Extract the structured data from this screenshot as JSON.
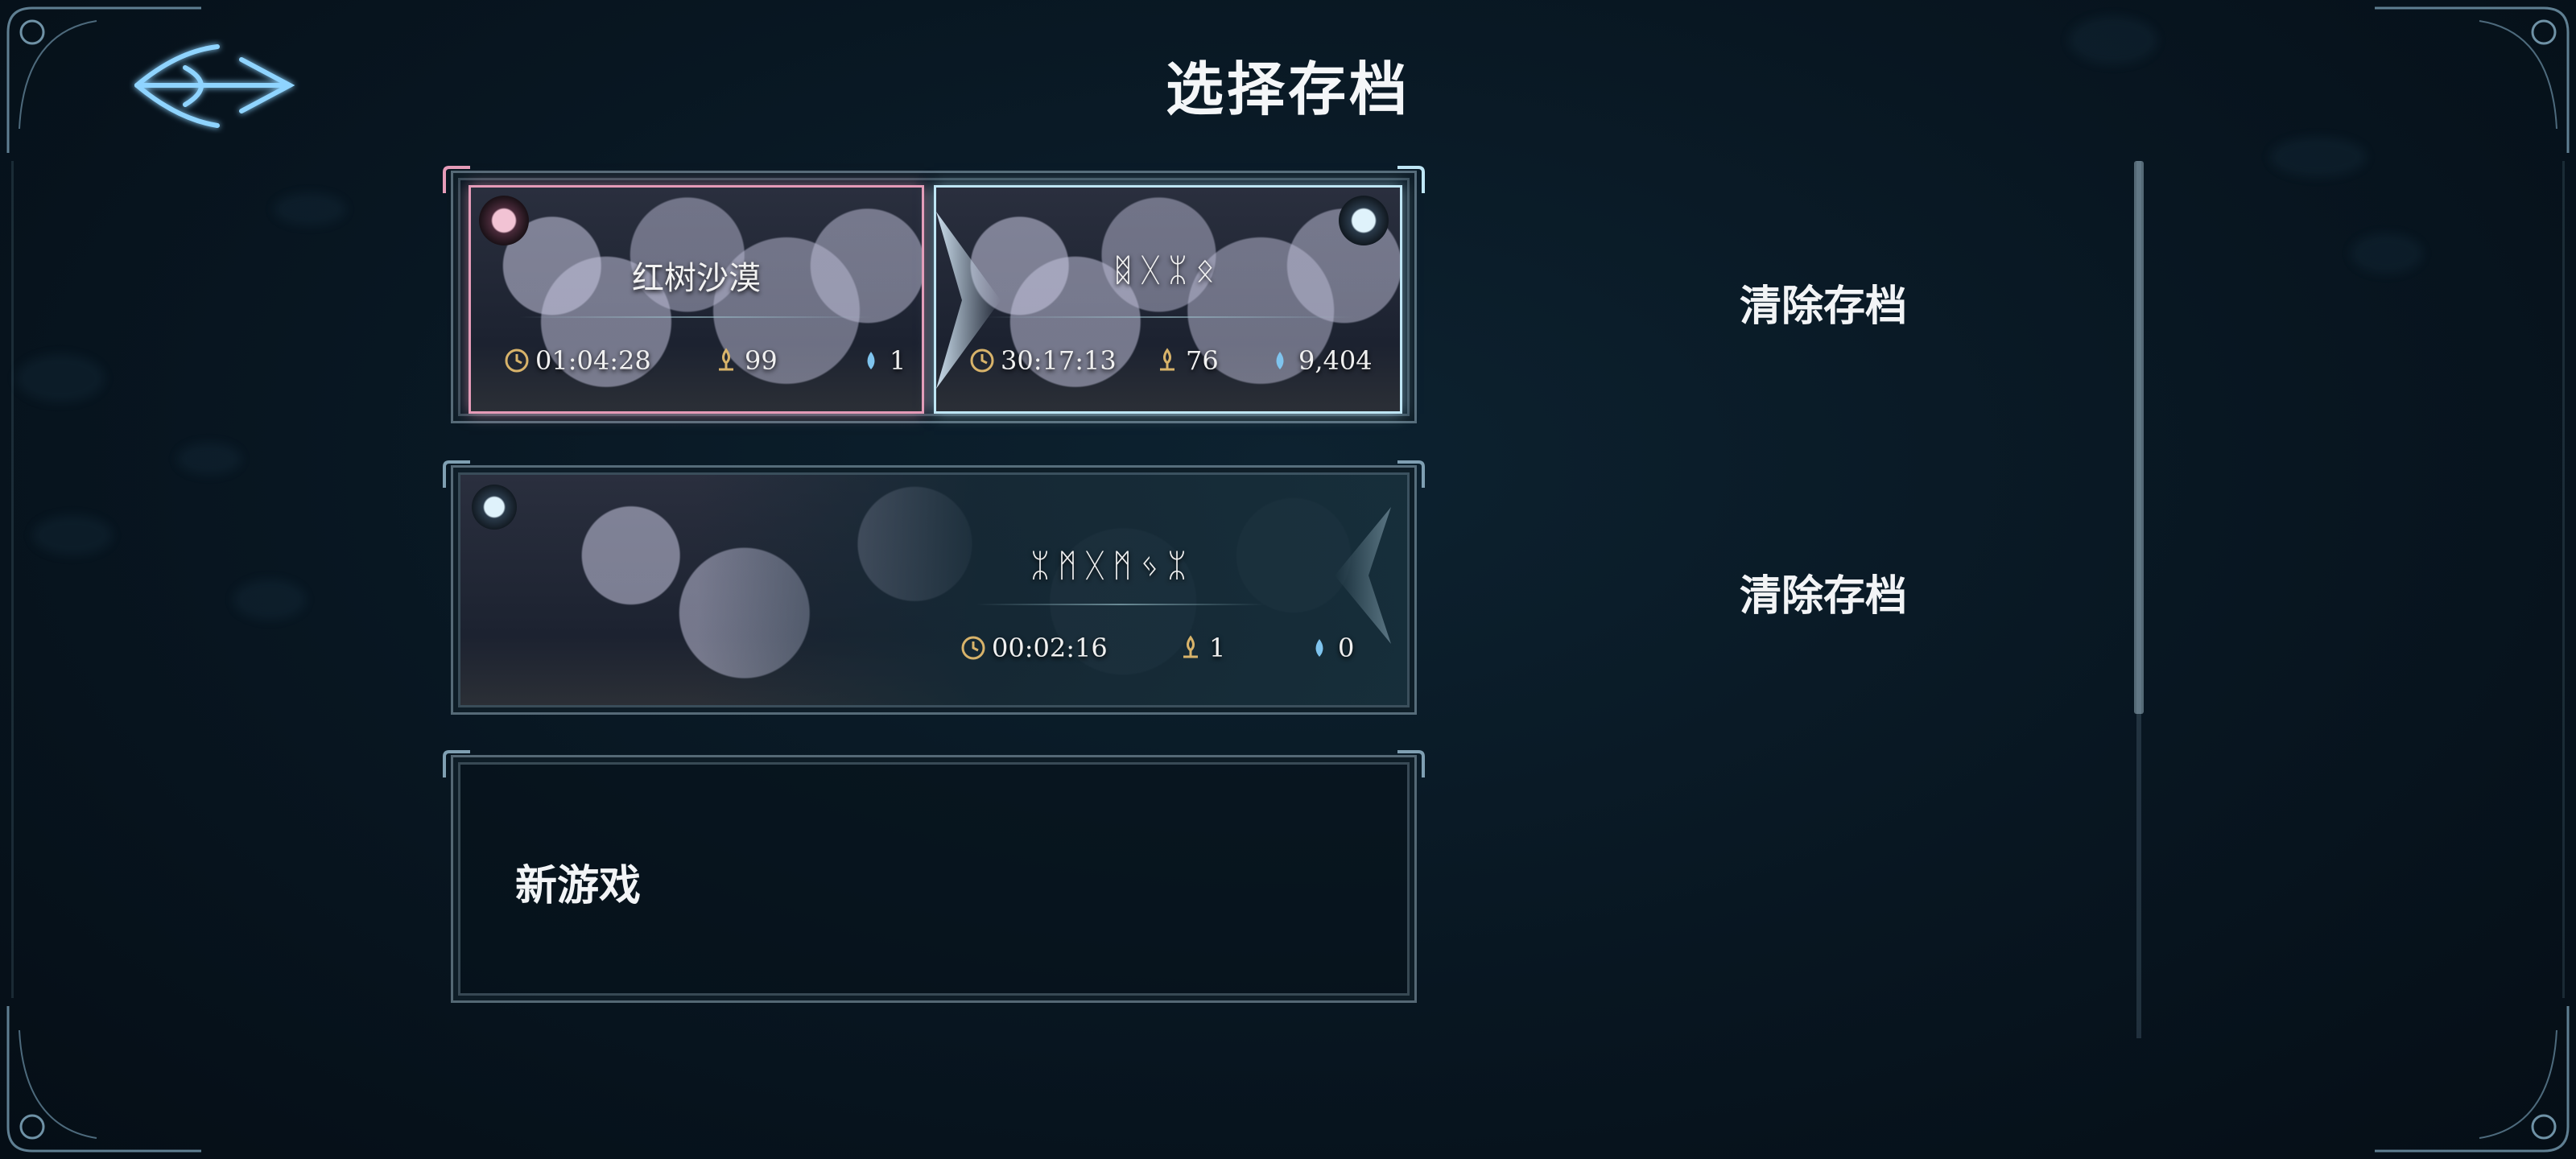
{
  "title": "选择存档",
  "icons": {
    "back": "back-arrow-icon",
    "time": "clock-icon",
    "level": "flame-sigil-icon",
    "currency": "droplet-icon"
  },
  "colors": {
    "accent_gold": "#d8b36a",
    "accent_blue": "#7fc4ee",
    "slot_pink": "#e59bb8",
    "slot_ice": "#bfe6f5"
  },
  "slots": [
    {
      "left_world": {
        "name": "红树沙漠",
        "time": "01:04:28",
        "level": "99",
        "currency": "1"
      },
      "right_world": {
        "name": "ᛥᚷᛯᛟ",
        "time": "30:17:13",
        "level": "76",
        "currency": "9,404"
      },
      "clear_label": "清除存档"
    },
    {
      "world": {
        "name": "ᛯᛗᚷᛗᛃᛯ",
        "time": "00:02:16",
        "level": "1",
        "currency": "0"
      },
      "clear_label": "清除存档"
    }
  ],
  "new_game": {
    "label": "新游戏"
  },
  "scroll": {
    "position_fraction": 0.0,
    "visible_fraction": 0.63
  }
}
